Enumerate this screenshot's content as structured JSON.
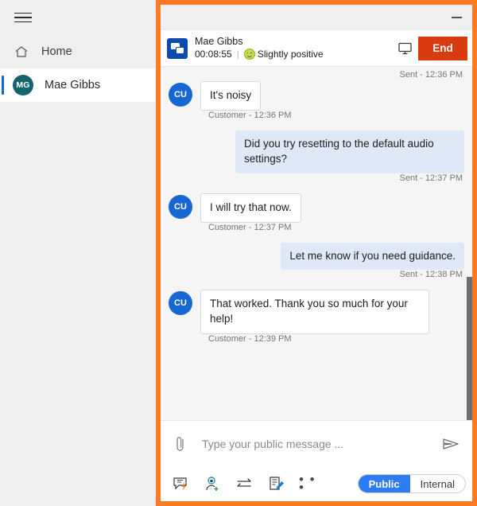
{
  "sidebar": {
    "menu_icon": "hamburger-icon",
    "items": [
      {
        "label": "Home",
        "icon": "home-icon",
        "selected": false
      },
      {
        "label": "Mae Gibbs",
        "icon": "avatar",
        "initials": "MG",
        "selected": true
      }
    ]
  },
  "window": {
    "minimize_label": "Minimize",
    "border_color": "#fc7a26"
  },
  "conversation": {
    "icon": "chat-bubbles-icon",
    "customer_name": "Mae Gibbs",
    "duration": "00:08:55",
    "separator": "|",
    "sentiment_icon": "slightly-positive-smiley-icon",
    "sentiment": "Slightly positive",
    "monitor_icon": "monitor-screen-icon",
    "end_label": "End",
    "end_color": "#d93b10"
  },
  "messages": [
    {
      "stamp": "Sent - 12:36 PM",
      "side": "right",
      "stamp_only": true
    },
    {
      "side": "left",
      "avatar": "CU",
      "text": "It's noisy",
      "stamp": "Customer - 12:36 PM"
    },
    {
      "side": "right",
      "text": "Did you try resetting to the default audio settings?",
      "stamp": "Sent - 12:37 PM"
    },
    {
      "side": "left",
      "avatar": "CU",
      "text": "I will try that now.",
      "stamp": "Customer - 12:37 PM"
    },
    {
      "side": "right",
      "text": "Let me know if you need guidance.",
      "stamp": "Sent - 12:38 PM"
    },
    {
      "side": "left",
      "avatar": "CU",
      "text": "That worked. Thank you so much for your help!",
      "stamp": "Customer - 12:39 PM"
    }
  ],
  "composer": {
    "attach_icon": "paperclip-icon",
    "placeholder": "Type your public message ...",
    "value": "",
    "send_icon": "send-arrow-icon"
  },
  "toolbar": {
    "buttons": [
      {
        "icon": "quick-reply-icon",
        "label": "Quick reply"
      },
      {
        "icon": "add-agent-icon",
        "label": "Add agent"
      },
      {
        "icon": "transfer-icon",
        "label": "Transfer"
      },
      {
        "icon": "notes-icon",
        "label": "Notes"
      },
      {
        "icon": "more-icon",
        "label": "More",
        "glyph": "• • •"
      }
    ],
    "toggle": {
      "public_label": "Public",
      "internal_label": "Internal",
      "active": "Public",
      "active_color": "#2e7bf6"
    }
  }
}
